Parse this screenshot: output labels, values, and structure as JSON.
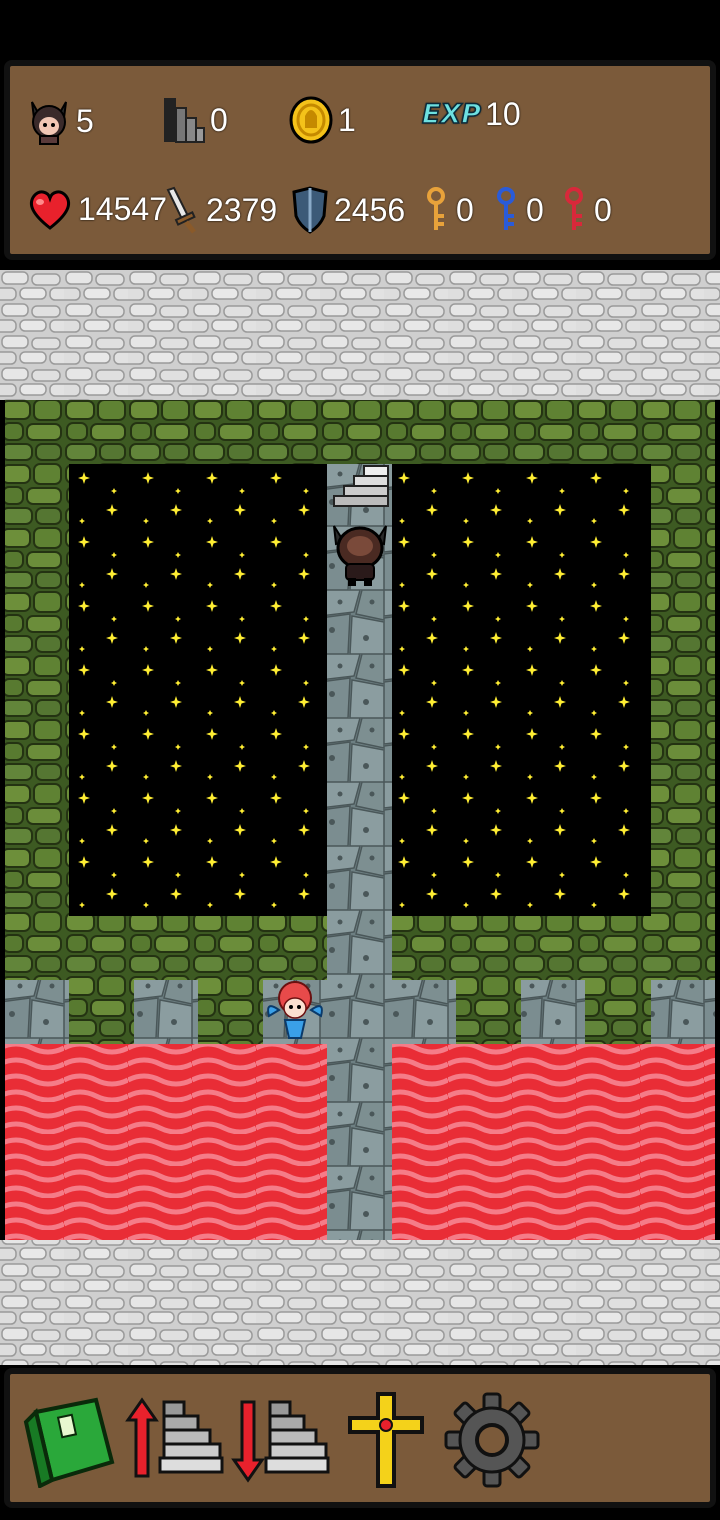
{
  "hud": {
    "row1": [
      {
        "name": "floor-level",
        "icon": "hero-portrait-icon",
        "value": "5"
      },
      {
        "name": "stairs-count",
        "icon": "stairs-icon",
        "value": "0"
      },
      {
        "name": "gold",
        "icon": "coin-icon",
        "value": "1"
      },
      {
        "name": "experience",
        "icon": "exp-label-icon",
        "label": "EXP",
        "value": "10"
      }
    ],
    "row2": [
      {
        "name": "hp",
        "icon": "heart-icon",
        "value": "14547"
      },
      {
        "name": "attack",
        "icon": "sword-icon",
        "value": "2379"
      },
      {
        "name": "defense",
        "icon": "shield-icon",
        "value": "2456"
      },
      {
        "name": "yellow-keys",
        "icon": "yellow-key-icon",
        "value": "0"
      },
      {
        "name": "blue-keys",
        "icon": "blue-key-icon",
        "value": "0"
      },
      {
        "name": "red-keys",
        "icon": "red-key-icon",
        "value": "0"
      }
    ]
  },
  "colors": {
    "panel": "#7b5a3a",
    "lava": "#e92d36",
    "moss": "#4f6f2f",
    "stone": "#cfcfcf",
    "floor": "#7d8f91",
    "star": "#ffee33",
    "yellow_key": "#e8a23a",
    "blue_key": "#2a5bd8",
    "red_key": "#d8283a"
  },
  "toolbar": [
    {
      "name": "monster-book-button",
      "icon": "book-icon"
    },
    {
      "name": "floor-up-button",
      "icon": "stairs-up-icon"
    },
    {
      "name": "floor-down-button",
      "icon": "stairs-down-icon"
    },
    {
      "name": "holy-cross-button",
      "icon": "cross-icon"
    },
    {
      "name": "settings-button",
      "icon": "gear-icon"
    }
  ]
}
